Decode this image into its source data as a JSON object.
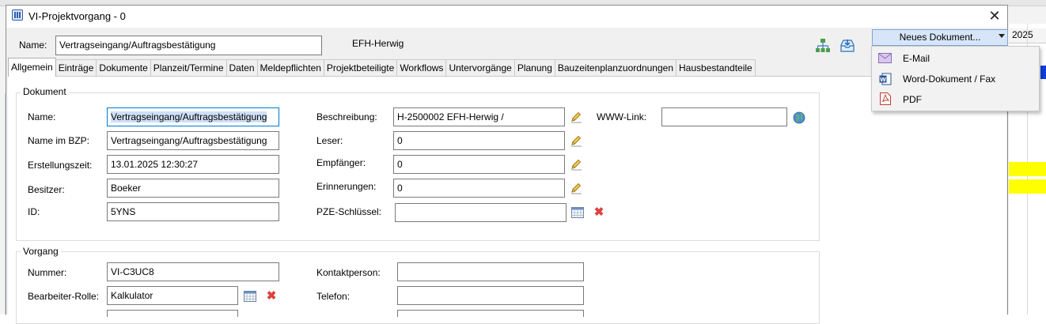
{
  "background": {
    "calendar_year": "2025",
    "colors": {
      "blue_bar": "#0f3fd6",
      "yellow_bar": "#ffff00"
    }
  },
  "window": {
    "title": "VI-Projektvorgang - 0",
    "close_glyph": "✕"
  },
  "header": {
    "name_label": "Name:",
    "name_value": "Vertragseingang/Auftragsbestätigung",
    "project_label": "EFH-Herwig",
    "toolbar_icons": [
      "hierarchy-icon",
      "inbox-download-icon"
    ]
  },
  "tabs": [
    {
      "label": "Allgemein",
      "active": true
    },
    {
      "label": "Einträge"
    },
    {
      "label": "Dokumente"
    },
    {
      "label": "Planzeit/Termine"
    },
    {
      "label": "Daten"
    },
    {
      "label": "Meldepflichten"
    },
    {
      "label": "Projektbeteiligte"
    },
    {
      "label": "Workflows"
    },
    {
      "label": "Untervorgänge"
    },
    {
      "label": "Planung"
    },
    {
      "label": "Bauzeitenplanzuordnungen"
    },
    {
      "label": "Hausbestandteile"
    }
  ],
  "dokument": {
    "title": "Dokument",
    "fields": {
      "name": {
        "label": "Name:",
        "value": "Vertragseingang/Auftragsbestätigung"
      },
      "name_bzp": {
        "label": "Name im BZP:",
        "value": "Vertragseingang/Auftragsbestätigung"
      },
      "erstellungszeit": {
        "label": "Erstellungszeit:",
        "value": "13.01.2025 12:30:27"
      },
      "besitzer": {
        "label": "Besitzer:",
        "value": "Boeker"
      },
      "id": {
        "label": "ID:",
        "value": "5YNS"
      },
      "beschreibung": {
        "label": "Beschreibung:",
        "value": "H-2500002 EFH-Herwig /"
      },
      "leser": {
        "label": "Leser:",
        "value": "0"
      },
      "empfaenger": {
        "label": "Empfänger:",
        "value": "0"
      },
      "erinnerungen": {
        "label": "Erinnerungen:",
        "value": "0"
      },
      "pze_schluessel": {
        "label": "PZE-Schlüssel:",
        "value": ""
      },
      "www_link": {
        "label": "WWW-Link:",
        "value": ""
      }
    }
  },
  "vorgang": {
    "title": "Vorgang",
    "fields": {
      "nummer": {
        "label": "Nummer:",
        "value": "VI-C3UC8"
      },
      "bearbeiter_rolle": {
        "label": "Bearbeiter-Rolle:",
        "value": "Kalkulator"
      },
      "kontaktperson": {
        "label": "Kontaktperson:",
        "value": ""
      },
      "telefon": {
        "label": "Telefon:",
        "value": ""
      }
    }
  },
  "new_document_menu": {
    "button_label": "Neues Dokument...",
    "items": [
      {
        "label": "E-Mail",
        "icon": "envelope-icon"
      },
      {
        "label": "Word-Dokument / Fax",
        "icon": "word-document-icon"
      },
      {
        "label": "PDF",
        "icon": "pdf-icon"
      }
    ]
  }
}
